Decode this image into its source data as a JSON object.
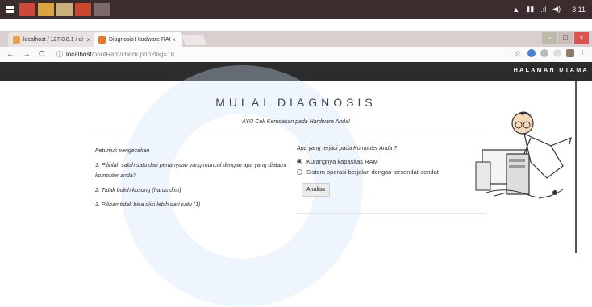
{
  "taskbar": {
    "tray_time": "3:11"
  },
  "browser": {
    "tabs": [
      {
        "label": "localhost / 127.0.0.1 / di",
        "close": "×"
      },
      {
        "label": "Diagnosis Hardware RAI",
        "close": "×"
      }
    ],
    "window_controls": [
      "−",
      "□",
      "×"
    ],
    "url_host": "localhost",
    "url_path": "/bootRam/check.php?tag=16"
  },
  "navbar": {
    "home_link": "HALAMAN UTAMA"
  },
  "page": {
    "title": "MULAI DIAGNOSIS",
    "subtitle": "AYO Cek Kerusakan pada Hardware Anda!",
    "instructions_heading": "Petunjuk pengecekan",
    "instructions": [
      "1. Pilihlah salah satu dari pertanyaan yang muncul dengan apa yang dialami komputer anda?",
      "2. Tidak boleh kosong (harus diisi)",
      "3. Pilihan tidak bisa diisi lebih dari satu (1)"
    ],
    "question": "Apa yang terjadi pada Komputer Anda ?",
    "options": [
      {
        "label": "Kurangnya kapasitas RAM",
        "checked": true
      },
      {
        "label": "Sistem operasi berjalan dengan tersendat-sendat",
        "checked": false
      }
    ],
    "submit_label": "Analisa"
  },
  "colors": {
    "navbar_bg": "#2c2c2c",
    "taskbar_bg": "#3b2d2d",
    "accent_orange": "#e8782e"
  }
}
